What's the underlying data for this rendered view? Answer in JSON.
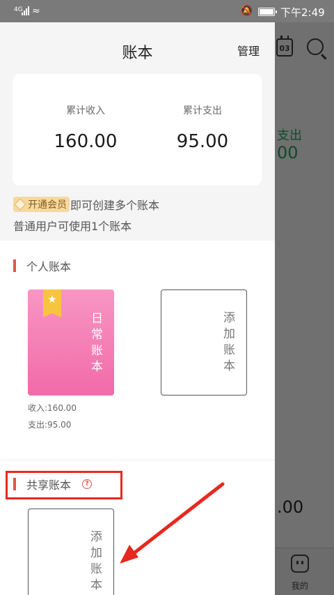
{
  "status_bar": {
    "network": "4G",
    "time": "下午2:49"
  },
  "background_screen": {
    "expense_label": "支出",
    "expense_value": "00",
    "bottom_value": ".00",
    "tab_mine_label": "我的",
    "calendar_day": "03"
  },
  "drawer": {
    "title": "账本",
    "manage_label": "管理",
    "summary": {
      "income_label": "累计收入",
      "income_value": "160.00",
      "expense_label": "累计支出",
      "expense_value": "95.00"
    },
    "vip_badge_label": "开通会员",
    "vip_text": "即可创建多个账本",
    "plain_user_text": "普通用户可使用1个账本",
    "personal_section": {
      "title": "个人账本",
      "book": {
        "name": "日常账本",
        "star": "★",
        "income": "收入:160.00",
        "expense": "支出:95.00"
      },
      "add_label": "添加账本"
    },
    "shared_section": {
      "title": "共享账本",
      "help": "?",
      "add_label": "添加账本"
    }
  },
  "annotation": {
    "highlight_color": "#e7281e"
  }
}
